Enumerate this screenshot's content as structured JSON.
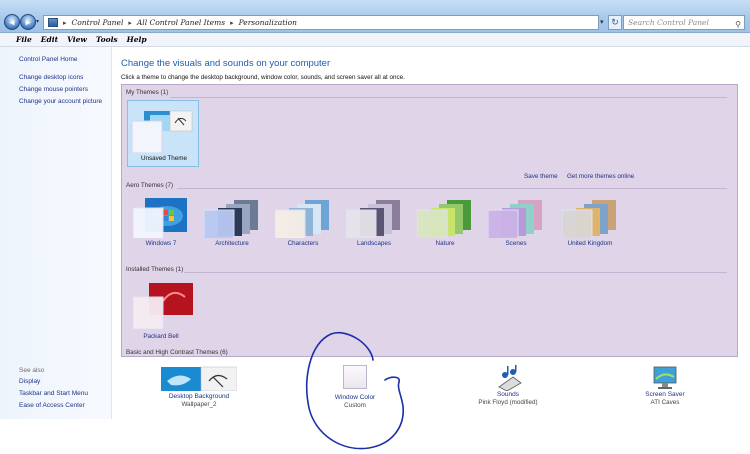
{
  "window": {
    "breadcrumb": [
      "Control Panel",
      "All Control Panel Items",
      "Personalization"
    ],
    "breadcrumb_separator": "▸",
    "search_placeholder": "Search Control Panel"
  },
  "menu": [
    "File",
    "Edit",
    "View",
    "Tools",
    "Help"
  ],
  "left_pane": {
    "home": "Control Panel Home",
    "links": [
      "Change desktop icons",
      "Change mouse pointers",
      "Change your account picture"
    ],
    "see_also_label": "See also",
    "see_also": [
      "Display",
      "Taskbar and Start Menu",
      "Ease of Access Center"
    ]
  },
  "main": {
    "title": "Change the visuals and sounds on your computer",
    "subtitle": "Click a theme to change the desktop background, window color, sounds, and screen saver all at once."
  },
  "themes": {
    "my_themes_label": "My Themes (1)",
    "unsaved_theme": "Unsaved Theme",
    "save_theme": "Save theme",
    "get_more": "Get more themes online",
    "aero_label": "Aero Themes (7)",
    "aero": [
      "Windows 7",
      "Architecture",
      "Characters",
      "Landscapes",
      "Nature",
      "Scenes",
      "United Kingdom"
    ],
    "installed_label": "Installed Themes (1)",
    "installed": [
      "Packard Bell"
    ],
    "basic_label": "Basic and High Contrast Themes (6)"
  },
  "bottom": {
    "desktop_background": {
      "title": "Desktop Background",
      "value": "Wallpaper_2"
    },
    "window_color": {
      "title": "Window Color",
      "value": "Custom"
    },
    "sounds": {
      "title": "Sounds",
      "value": "Pink Floyd (modified)"
    },
    "screen_saver": {
      "title": "Screen Saver",
      "value": "ATI Caves"
    }
  },
  "colors": {
    "link": "#1e3287",
    "accent": "#1e5eaf",
    "theme_area": "#dfd4e8",
    "annotation": "#1a2fa8"
  }
}
